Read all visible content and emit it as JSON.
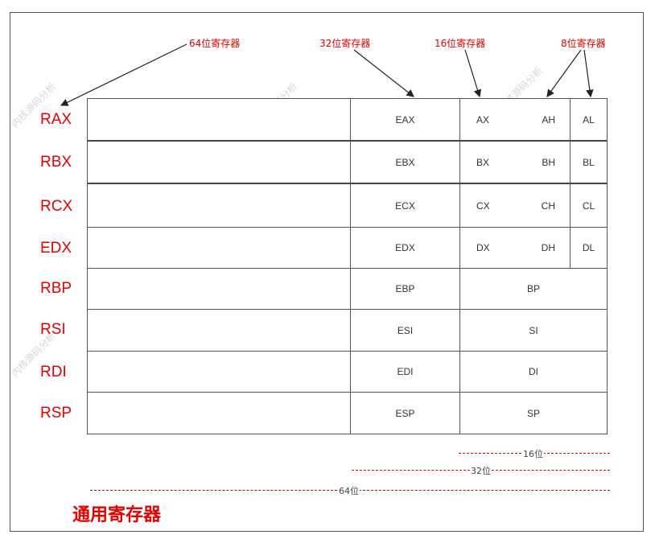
{
  "headers": {
    "r64": "64位寄存器",
    "r32": "32位寄存器",
    "r16": "16位寄存器",
    "r8": "8位寄存器"
  },
  "registers": [
    {
      "r64": "RAX",
      "r32": "EAX",
      "r16": "AX",
      "r8h": "AH",
      "r8l": "AL"
    },
    {
      "r64": "RBX",
      "r32": "EBX",
      "r16": "BX",
      "r8h": "BH",
      "r8l": "BL"
    },
    {
      "r64": "RCX",
      "r32": "ECX",
      "r16": "CX",
      "r8h": "CH",
      "r8l": "CL"
    },
    {
      "r64": "EDX",
      "r32": "EDX",
      "r16": "DX",
      "r8h": "DH",
      "r8l": "DL"
    },
    {
      "r64": "RBP",
      "r32": "EBP",
      "r16": "BP"
    },
    {
      "r64": "RSI",
      "r32": "ESI",
      "r16": "SI"
    },
    {
      "r64": "RDI",
      "r32": "EDI",
      "r16": "DI"
    },
    {
      "r64": "RSP",
      "r32": "ESP",
      "r16": "SP"
    }
  ],
  "spans": {
    "b16": "16位",
    "b32": "32位",
    "b64": "64位"
  },
  "title": "通用寄存器",
  "colors": {
    "accent": "#e60000",
    "line": "#555555"
  }
}
